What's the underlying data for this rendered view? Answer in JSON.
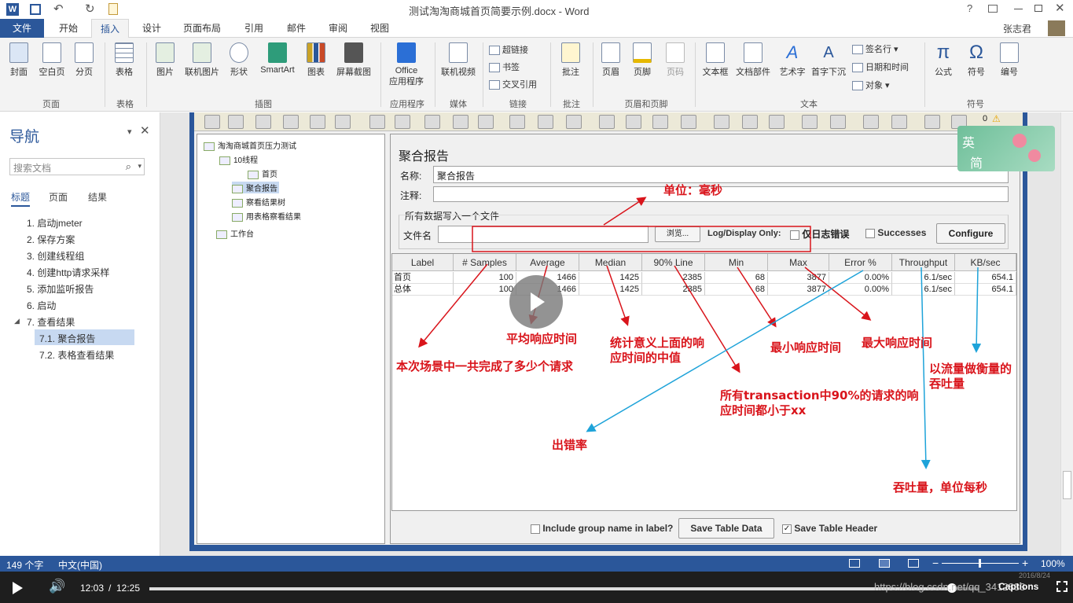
{
  "window": {
    "title": "测试淘淘商城首页简要示例.docx - Word",
    "help": "?"
  },
  "tabs": {
    "file": "文件",
    "items": [
      "开始",
      "插入",
      "设计",
      "页面布局",
      "引用",
      "邮件",
      "审阅",
      "视图"
    ],
    "user": "张志君"
  },
  "ribbon": {
    "buttons": [
      "封面",
      "空白页",
      "分页",
      "表格",
      "图片",
      "联机图片",
      "形状",
      "SmartArt",
      "图表",
      "屏幕截图",
      "Office\n应用程序",
      "联机视频",
      "批注",
      "页眉",
      "页脚",
      "页码",
      "文本框",
      "文档部件",
      "艺术字",
      "首字下沉",
      "公式",
      "符号",
      "编号"
    ],
    "small": [
      "超链接",
      "书签",
      "交叉引用",
      "签名行",
      "日期和时间",
      "对象"
    ],
    "groups": [
      "页面",
      "表格",
      "插图",
      "应用程序",
      "媒体",
      "链接",
      "批注",
      "页眉和页脚",
      "文本",
      "符号"
    ]
  },
  "nav": {
    "title": "导航",
    "search_placeholder": "搜索文档",
    "tabs": [
      "标题",
      "页面",
      "结果"
    ],
    "items": [
      "1. 启动jmeter",
      "2. 保存方案",
      "3. 创建线程组",
      "4. 创建http请求采样",
      "5. 添加监听报告",
      "6. 启动",
      "7. 查看结果",
      "7.1. 聚合报告",
      "7.2. 表格查看结果"
    ]
  },
  "jmeter": {
    "toolbar_count": "0",
    "tree": [
      "淘淘商城首页压力测试",
      "10线程",
      "首页",
      "聚合报告",
      "察看结果树",
      "用表格察看结果",
      "工作台"
    ],
    "panel_title": "聚合报告",
    "name_label": "名称:",
    "name_value": "聚合报告",
    "comment_label": "注释:",
    "file_section": "所有数据写入一个文件",
    "file_label": "文件名",
    "browse": "浏览...",
    "log_only": "Log/Display Only:",
    "errors_only": "仅日志错误",
    "successes": "Successes",
    "configure": "Configure",
    "columns": [
      "Label",
      "# Samples",
      "Average",
      "Median",
      "90% Line",
      "Min",
      "Max",
      "Error %",
      "Throughput",
      "KB/sec"
    ],
    "rows": [
      [
        "首页",
        "100",
        "1466",
        "1425",
        "2385",
        "68",
        "3877",
        "0.00%",
        "6.1/sec",
        "654.1"
      ],
      [
        "总体",
        "100",
        "1466",
        "1425",
        "2385",
        "68",
        "3877",
        "0.00%",
        "6.1/sec",
        "654.1"
      ]
    ],
    "include_group": "Include group name in label?",
    "save_table": "Save Table Data",
    "save_header": "Save Table Header"
  },
  "annotations": {
    "unit": "单位：毫秒",
    "samples": "本次场景中一共完成了多少个请求",
    "average": "平均响应时间",
    "median": "统计意义上面的响应时间的中值",
    "min": "最小响应时间",
    "max": "最大响应时间",
    "line90": "所有transaction中90%的请求的响应时间都小于xx",
    "error": "出错率",
    "throughput": "吞吐量，单位每秒",
    "kb": "以流量做衡量的吞吐量"
  },
  "ime": {
    "a": "英",
    "b": "简"
  },
  "status": {
    "words": "149 个字",
    "lang": "中文(中国)",
    "zoom": "100%"
  },
  "player": {
    "current": "12:03",
    "sep": "/",
    "total": "12:25",
    "url": "https://blog.csdn.net/qq_3412833",
    "captions": "Captions",
    "date": "2016/8/24",
    "progress": 0.968
  }
}
